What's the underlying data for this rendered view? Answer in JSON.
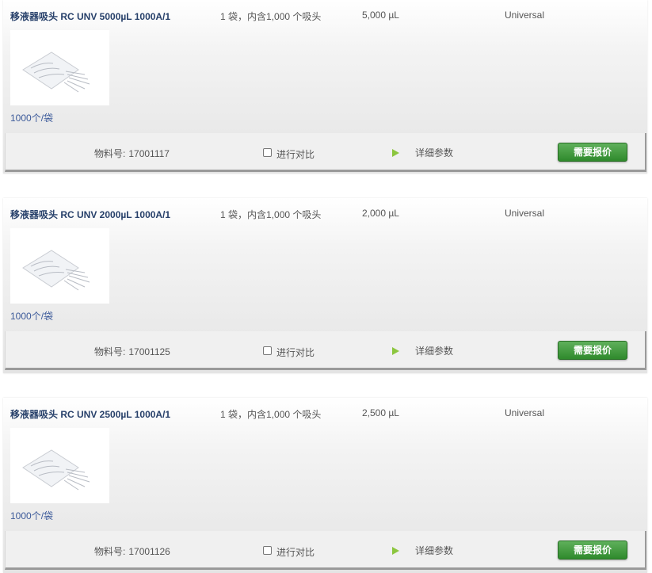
{
  "products": [
    {
      "title": "移液器吸头 RC UNV 5000µL 1000A/1",
      "pack": "1 袋，内含1,000 个吸头",
      "volume": "5,000 µL",
      "type": "Universal",
      "unit": "1000个/袋",
      "part_label": "物料号:",
      "part_number": "17001117",
      "compare_label": "进行对比",
      "details_label": "详细参数",
      "quote_label": "需要报价"
    },
    {
      "title": "移液器吸头 RC UNV 2000µL 1000A/1",
      "pack": "1 袋，内含1,000 个吸头",
      "volume": "2,000 µL",
      "type": "Universal",
      "unit": "1000个/袋",
      "part_label": "物料号:",
      "part_number": "17001125",
      "compare_label": "进行对比",
      "details_label": "详细参数",
      "quote_label": "需要报价"
    },
    {
      "title": "移液器吸头 RC UNV 2500µL 1000A/1",
      "pack": "1 袋，内含1,000 个吸头",
      "volume": "2,500 µL",
      "type": "Universal",
      "unit": "1000个/袋",
      "part_label": "物料号:",
      "part_number": "17001126",
      "compare_label": "进行对比",
      "details_label": "详细参数",
      "quote_label": "需要报价"
    }
  ],
  "icons": {
    "details": "play-arrow-icon",
    "compare": "checkbox-icon",
    "thumbnail": "pipette-tips-bag-image"
  },
  "colors": {
    "title": "#27406a",
    "unit_link": "#3c5a9a",
    "quote_button": "#3a923a",
    "play_icon": "#8cc63f"
  }
}
